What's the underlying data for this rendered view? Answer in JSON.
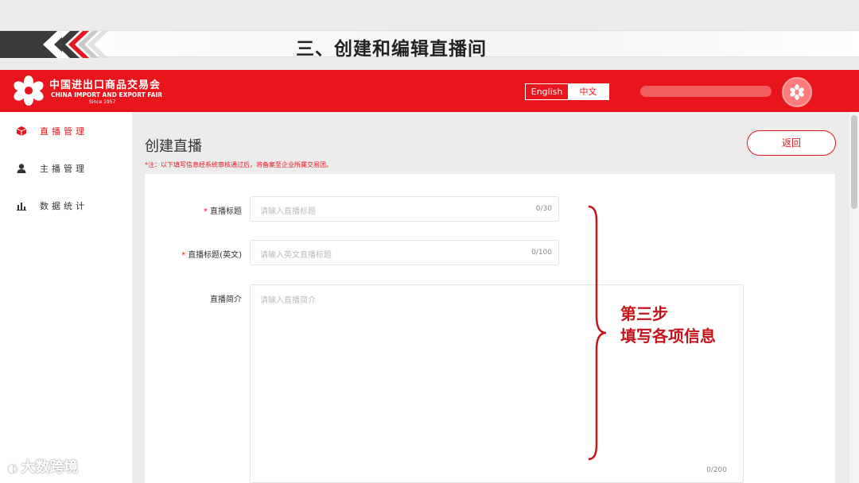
{
  "slide": {
    "title": "三、创建和编辑直播间"
  },
  "header": {
    "logo_cn": "中国进出口商品交易会",
    "logo_en": "CHINA IMPORT AND EXPORT FAIR",
    "logo_since": "Since 1957",
    "lang_en": "English",
    "lang_cn": "中文",
    "brand_color": "#e8151d"
  },
  "sidebar": {
    "items": [
      {
        "label": "直播管理",
        "icon": "cube-icon",
        "active": true
      },
      {
        "label": "主播管理",
        "icon": "user-icon",
        "active": false
      },
      {
        "label": "数据统计",
        "icon": "bar-chart-icon",
        "active": false
      }
    ]
  },
  "main": {
    "title": "创建直播",
    "note": "*注：以下填写信息经系统审核通过后，将备案至企业所属交易团。",
    "back_label": "返回",
    "fields": [
      {
        "label": "直播标题",
        "required": true,
        "placeholder": "请输入直播标题",
        "count": "0/30"
      },
      {
        "label": "直播标题(英文)",
        "required": true,
        "placeholder": "请输入英文直播标题",
        "count": "0/100"
      },
      {
        "label": "直播简介",
        "required": false,
        "placeholder": "请输入直播简介",
        "count": "0/200"
      }
    ]
  },
  "annotation": {
    "line1": "第三步",
    "line2": "填写各项信息",
    "color": "#c3141b"
  },
  "watermark": {
    "text": "大数跨境"
  }
}
